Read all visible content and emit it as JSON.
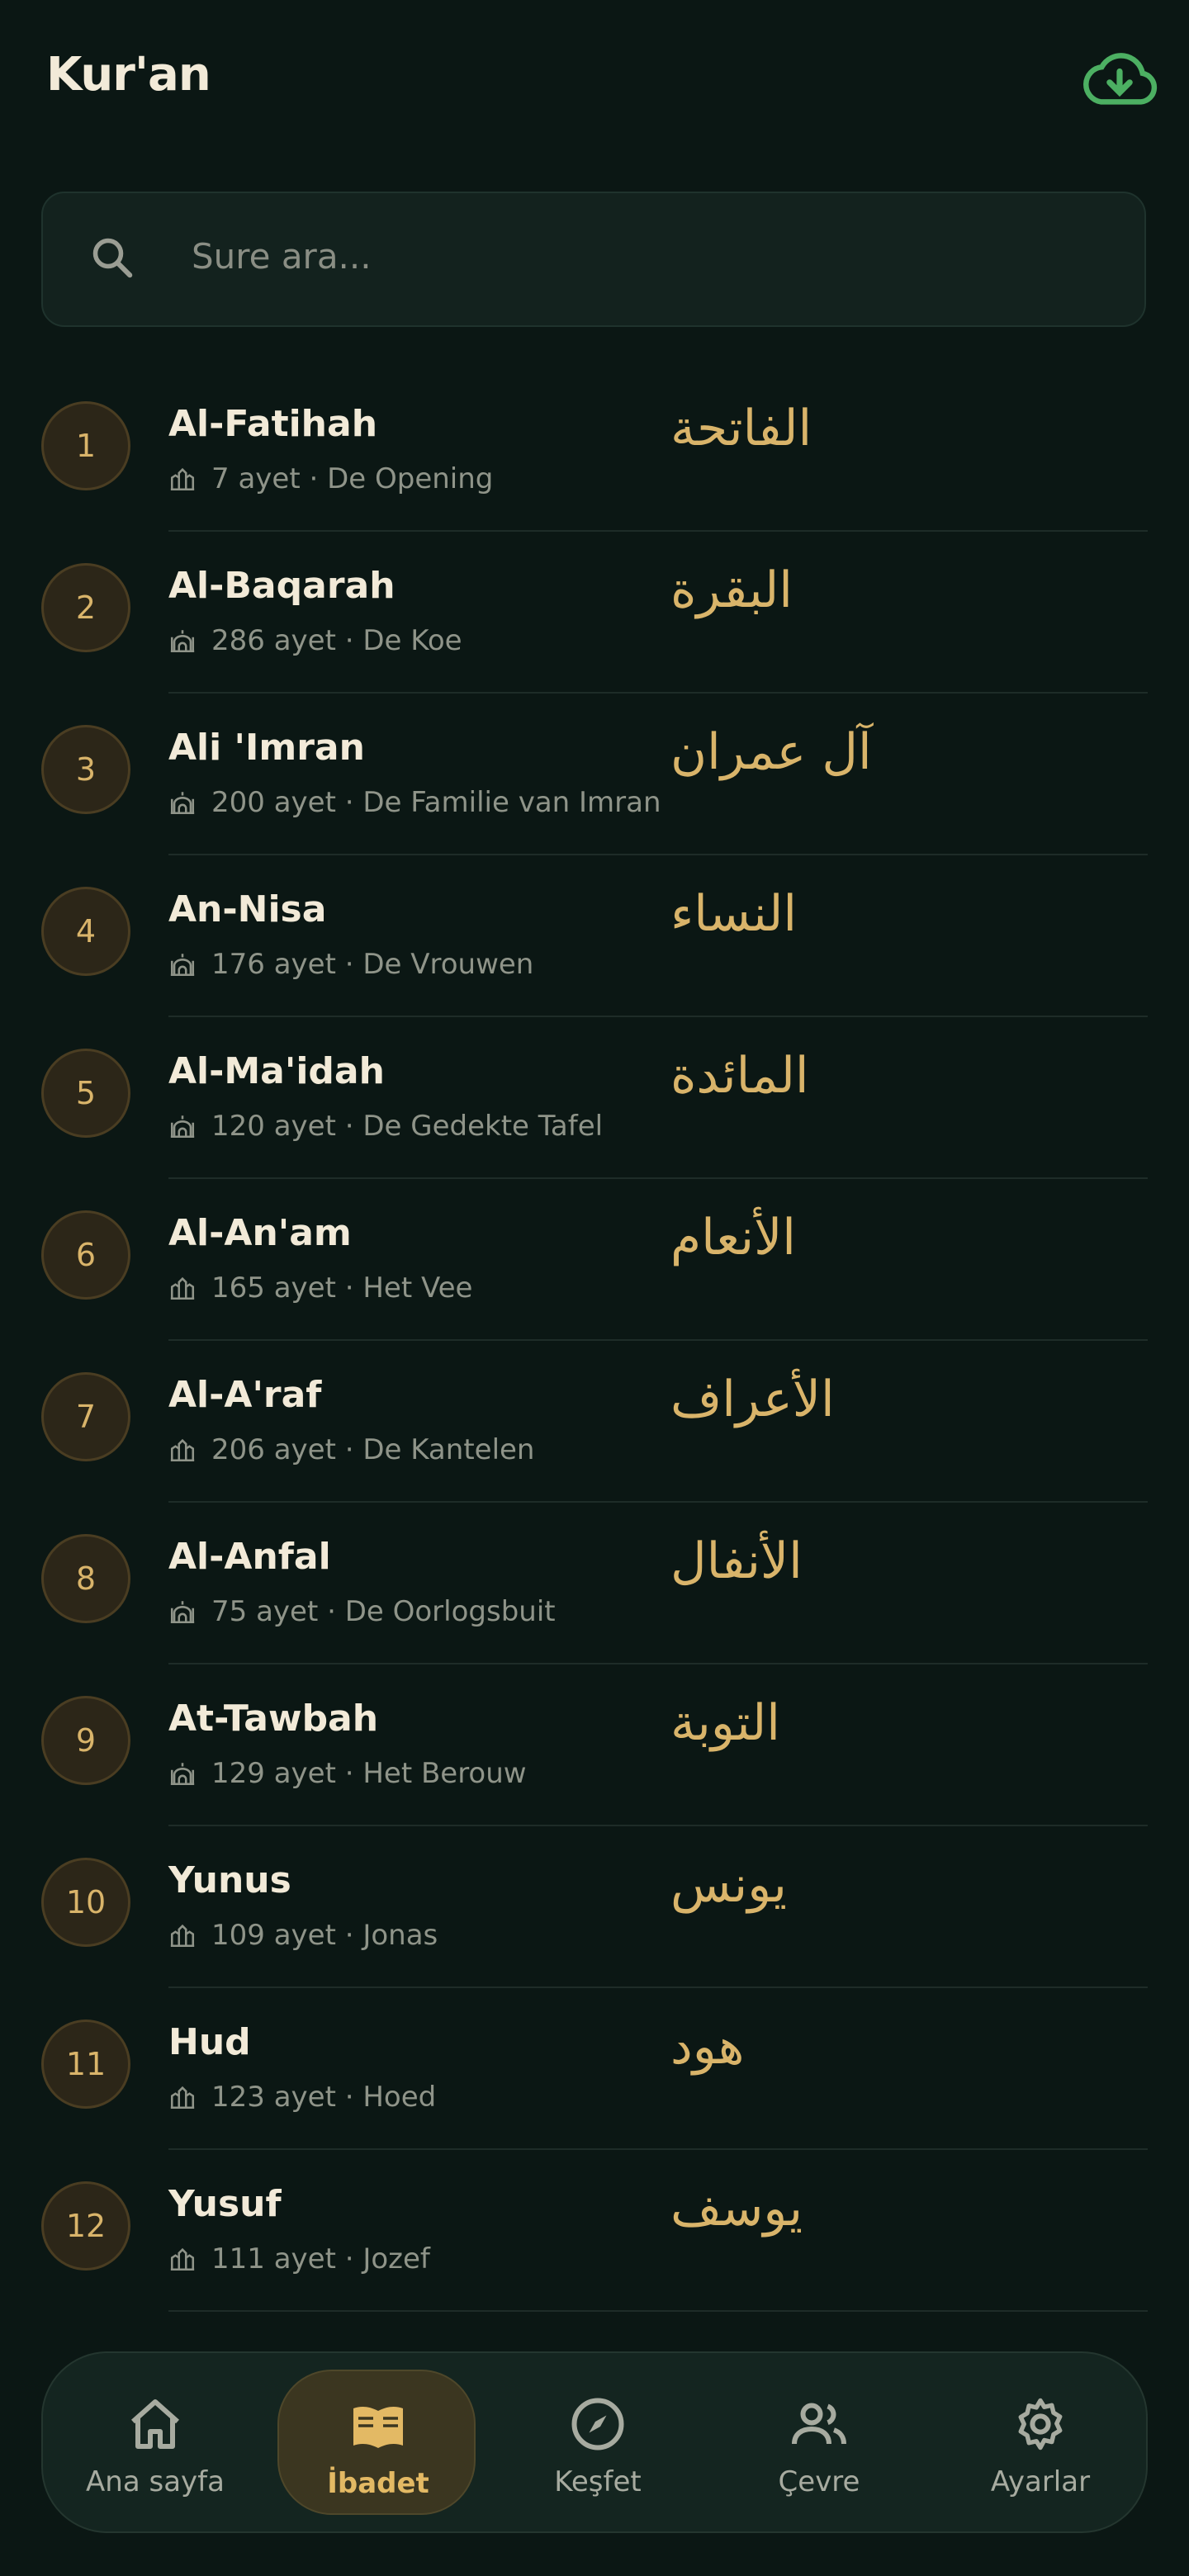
{
  "header": {
    "title": "Kur'an",
    "cloud_icon": "cloud-download-icon"
  },
  "search": {
    "placeholder": "Sure ara..."
  },
  "surahs": [
    {
      "num": "1",
      "name": "Al-Fatihah",
      "meta": "7 ayet · De Opening",
      "arabic": "الفاتحة",
      "place_icon": "mecca-icon"
    },
    {
      "num": "2",
      "name": "Al-Baqarah",
      "meta": "286 ayet · De Koe",
      "arabic": "البقرة",
      "place_icon": "medina-icon"
    },
    {
      "num": "3",
      "name": "Ali 'Imran",
      "meta": "200 ayet · De Familie van Imran",
      "arabic": "آل عمران",
      "place_icon": "medina-icon"
    },
    {
      "num": "4",
      "name": "An-Nisa",
      "meta": "176 ayet · De Vrouwen",
      "arabic": "النساء",
      "place_icon": "medina-icon"
    },
    {
      "num": "5",
      "name": "Al-Ma'idah",
      "meta": "120 ayet · De Gedekte Tafel",
      "arabic": "المائدة",
      "place_icon": "medina-icon"
    },
    {
      "num": "6",
      "name": "Al-An'am",
      "meta": "165 ayet · Het Vee",
      "arabic": "الأنعام",
      "place_icon": "mecca-icon"
    },
    {
      "num": "7",
      "name": "Al-A'raf",
      "meta": "206 ayet · De Kantelen",
      "arabic": "الأعراف",
      "place_icon": "mecca-icon"
    },
    {
      "num": "8",
      "name": "Al-Anfal",
      "meta": "75 ayet · De Oorlogsbuit",
      "arabic": "الأنفال",
      "place_icon": "medina-icon"
    },
    {
      "num": "9",
      "name": "At-Tawbah",
      "meta": "129 ayet · Het Berouw",
      "arabic": "التوبة",
      "place_icon": "medina-icon"
    },
    {
      "num": "10",
      "name": "Yunus",
      "meta": "109 ayet · Jonas",
      "arabic": "يونس",
      "place_icon": "mecca-icon"
    },
    {
      "num": "11",
      "name": "Hud",
      "meta": "123 ayet · Hoed",
      "arabic": "هود",
      "place_icon": "mecca-icon"
    },
    {
      "num": "12",
      "name": "Yusuf",
      "meta": "111 ayet · Jozef",
      "arabic": "يوسف",
      "place_icon": "mecca-icon"
    }
  ],
  "nav": [
    {
      "label": "Ana sayfa",
      "icon": "home-icon",
      "active": false
    },
    {
      "label": "İbadet",
      "icon": "book-icon",
      "active": true
    },
    {
      "label": "Keşfet",
      "icon": "compass-icon",
      "active": false
    },
    {
      "label": "Çevre",
      "icon": "people-icon",
      "active": false
    },
    {
      "label": "Ayarlar",
      "icon": "gear-icon",
      "active": false
    }
  ],
  "colors": {
    "background": "#0b1714",
    "accent": "#d9b46a",
    "cloud": "#4caf62"
  }
}
